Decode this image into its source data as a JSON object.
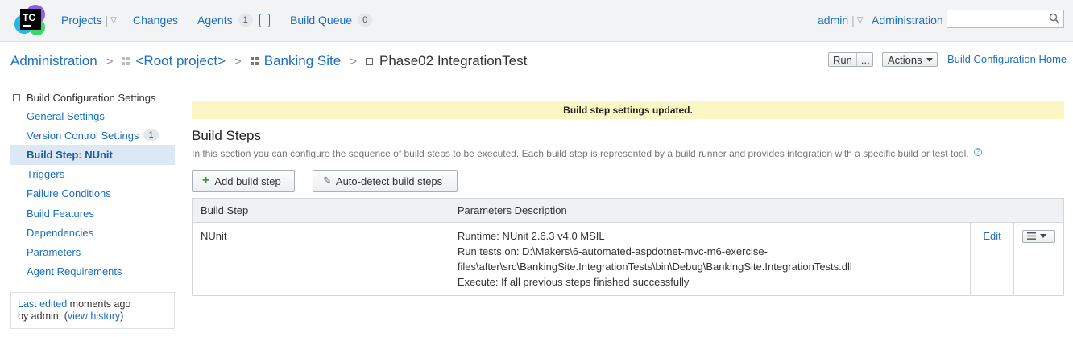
{
  "header": {
    "logo_text": "TC",
    "nav": {
      "projects": "Projects",
      "changes": "Changes",
      "agents": "Agents",
      "agents_count": "1",
      "build_queue": "Build Queue",
      "build_queue_count": "0",
      "user": "admin",
      "administration": "Administration"
    },
    "search": {
      "value": "",
      "placeholder": ""
    }
  },
  "breadcrumb": {
    "items": [
      "Administration",
      "<Root project>",
      "Banking Site",
      "Phase02 IntegrationTest"
    ]
  },
  "toolbar": {
    "run_label": "Run",
    "run_more": "...",
    "actions_label": "Actions",
    "home_link": "Build Configuration Home"
  },
  "sidebar": {
    "title": "Build Configuration Settings",
    "items": [
      {
        "label": "General Settings"
      },
      {
        "label": "Version Control Settings",
        "badge": "1"
      },
      {
        "label": "Build Step: NUnit",
        "active": true
      },
      {
        "label": "Triggers"
      },
      {
        "label": "Failure Conditions"
      },
      {
        "label": "Build Features"
      },
      {
        "label": "Dependencies"
      },
      {
        "label": "Parameters"
      },
      {
        "label": "Agent Requirements"
      }
    ],
    "last_edit": {
      "link": "Last edited",
      "when": "moments ago",
      "by_prefix": "by admin",
      "history_link": "view history"
    }
  },
  "main": {
    "notice": "Build step settings updated.",
    "title": "Build Steps",
    "description": "In this section you can configure the sequence of build steps to be executed. Each build step is represented by a build runner and provides integration with a specific build or test tool.",
    "add_button": "Add build step",
    "autodetect_button": "Auto-detect build steps",
    "table": {
      "headers": [
        "Build Step",
        "Parameters Description"
      ],
      "rows": [
        {
          "step": "NUnit",
          "params": [
            "Runtime: NUnit 2.6.3 v4.0 MSIL",
            "Run tests on: D:\\Makers\\6-automated-aspdotnet-mvc-m6-exercise-",
            "files\\after\\src\\BankingSite.IntegrationTests\\bin\\Debug\\BankingSite.IntegrationTests.dll",
            "Execute: If all previous steps finished successfully"
          ],
          "edit": "Edit"
        }
      ]
    }
  }
}
